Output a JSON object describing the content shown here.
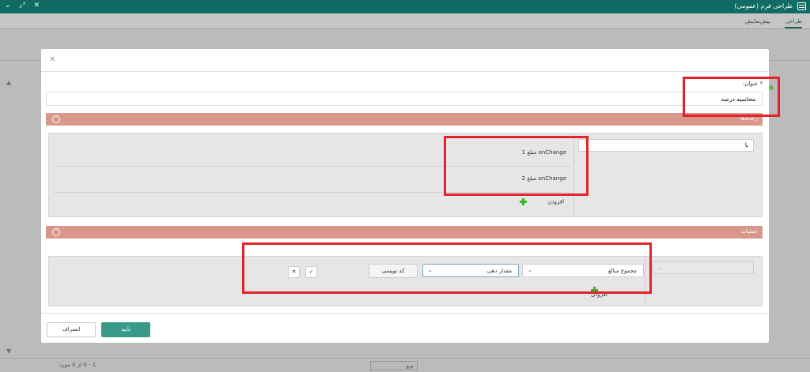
{
  "window": {
    "title": "طراحی فرم (عمومی)",
    "controls": "⌄ ⤢ ✕"
  },
  "background": {
    "tab_design": "طراحی",
    "tab_preview": "پیش‌نمایش",
    "paging_info": "1 - 0 از 0 مورد",
    "pager_text": "برو"
  },
  "modal": {
    "close": "✕",
    "title_label": "* عنوان:",
    "title_value": "محاسبه درصد",
    "sections": {
      "triggers": {
        "label": "رخدادها",
        "collapse": "⌃",
        "variable_value": "با",
        "params": [
          "مبلغ 1 onChange",
          "مبلغ 2 onChange"
        ],
        "add_label": "افزودن"
      },
      "operations": {
        "label": "عملیات",
        "collapse": "⌃",
        "left_select": "",
        "func_select": "مجموع مبالغ",
        "assign_select": "مقدار دهی",
        "code_button": "کد نویسی",
        "confirm_icon": "✓",
        "remove_icon": "✕",
        "add_label": "افزودن"
      }
    },
    "ok_label": "تایید",
    "cancel_label": "انصراف"
  },
  "colors": {
    "titlebar": "#0f6b63",
    "section_header": "#d9978c",
    "ok_button": "#3a9a8a",
    "highlight": "#e3232c",
    "plus": "#3fae2a"
  }
}
